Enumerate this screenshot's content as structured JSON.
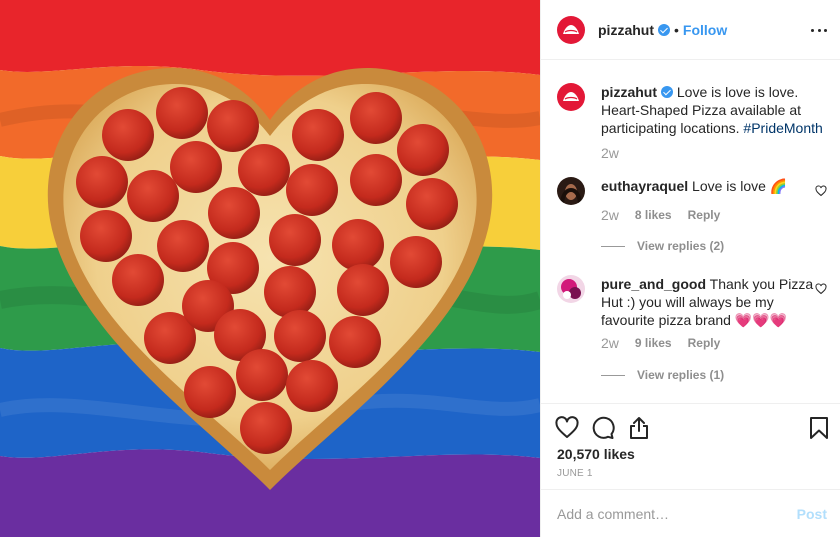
{
  "post": {
    "image_alt": "heart-shaped pepperoni pizza on rainbow flag",
    "flag_colors": [
      "#e8252b",
      "#f26a2a",
      "#f7cf3a",
      "#2e9b4a",
      "#1e64c8",
      "#6a2ea0"
    ]
  },
  "header": {
    "username": "pizzahut",
    "separator": "•",
    "follow_label": "Follow"
  },
  "caption": {
    "username": "pizzahut",
    "text": "Love is love is love. Heart-Shaped Pizza available at participating locations.",
    "hashtag": "#PrideMonth",
    "time": "2w"
  },
  "comments": [
    {
      "username": "euthayraquel",
      "text": "Love is love 🌈",
      "time": "2w",
      "likes": "8 likes",
      "reply_label": "Reply",
      "view_replies": "View replies (2)"
    },
    {
      "username": "pure_and_good",
      "text": "Thank you Pizza Hut :) you will always be my favourite pizza brand 💗💗💗",
      "time": "2w",
      "likes": "9 likes",
      "reply_label": "Reply",
      "view_replies": "View replies (1)"
    }
  ],
  "actions": {
    "icons": [
      "heart-icon",
      "comment-icon",
      "share-icon",
      "bookmark-icon"
    ],
    "likes_count": "20,570 likes",
    "date": "JUNE 1"
  },
  "add_comment": {
    "placeholder": "Add a comment…",
    "post_label": "Post"
  },
  "colors": {
    "accent": "#3897f0",
    "brand": "#e31837",
    "muted": "#8e8e8e"
  }
}
